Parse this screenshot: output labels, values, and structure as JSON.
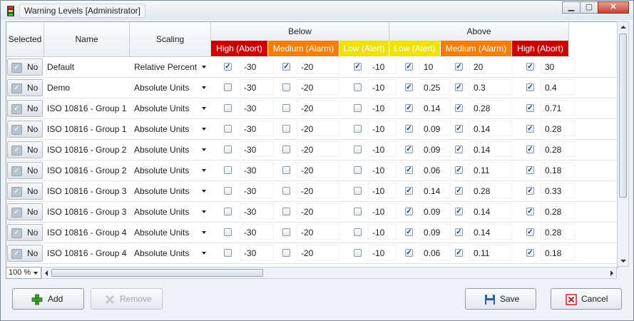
{
  "window": {
    "title": "Warning Levels [Administrator]"
  },
  "colors": {
    "high": "#cc0000",
    "medium": "#ff7b00",
    "low": "#f0e200",
    "checkmark": "#1a3d6b"
  },
  "columns": {
    "selected": "Selected",
    "name": "Name",
    "scaling": "Scaling",
    "below": "Below",
    "above": "Above",
    "below_sub": [
      "High (Abort)",
      "Medium (Alarm)",
      "Low (Alert)"
    ],
    "above_sub": [
      "Low (Alert)",
      "Medium (Alarm)",
      "High (Abort)"
    ]
  },
  "rows": [
    {
      "selected": "No",
      "name": "Default",
      "scaling": "Relative Percent",
      "below": [
        {
          "checked": true,
          "value": "-30"
        },
        {
          "checked": true,
          "value": "-20"
        },
        {
          "checked": true,
          "value": "-10"
        }
      ],
      "above": [
        {
          "checked": true,
          "value": "10"
        },
        {
          "checked": true,
          "value": "20"
        },
        {
          "checked": true,
          "value": "30"
        }
      ]
    },
    {
      "selected": "No",
      "name": "Demo",
      "scaling": "Absolute Units",
      "below": [
        {
          "checked": false,
          "value": "-30"
        },
        {
          "checked": false,
          "value": "-20"
        },
        {
          "checked": false,
          "value": "-10"
        }
      ],
      "above": [
        {
          "checked": true,
          "value": "0.25"
        },
        {
          "checked": true,
          "value": "0.3"
        },
        {
          "checked": true,
          "value": "0.4"
        }
      ]
    },
    {
      "selected": "No",
      "name": "ISO 10816 - Group 1",
      "scaling": "Absolute Units",
      "below": [
        {
          "checked": false,
          "value": "-30"
        },
        {
          "checked": false,
          "value": "-20"
        },
        {
          "checked": false,
          "value": "-10"
        }
      ],
      "above": [
        {
          "checked": true,
          "value": "0.14"
        },
        {
          "checked": true,
          "value": "0.28"
        },
        {
          "checked": true,
          "value": "0.71"
        }
      ]
    },
    {
      "selected": "No",
      "name": "ISO 10816 - Group 1",
      "scaling": "Absolute Units",
      "below": [
        {
          "checked": false,
          "value": "-30"
        },
        {
          "checked": false,
          "value": "-20"
        },
        {
          "checked": false,
          "value": "-10"
        }
      ],
      "above": [
        {
          "checked": true,
          "value": "0.09"
        },
        {
          "checked": true,
          "value": "0.14"
        },
        {
          "checked": true,
          "value": "0.28"
        }
      ]
    },
    {
      "selected": "No",
      "name": "ISO 10816 - Group 2",
      "scaling": "Absolute Units",
      "below": [
        {
          "checked": false,
          "value": "-30"
        },
        {
          "checked": false,
          "value": "-20"
        },
        {
          "checked": false,
          "value": "-10"
        }
      ],
      "above": [
        {
          "checked": true,
          "value": "0.09"
        },
        {
          "checked": true,
          "value": "0.14"
        },
        {
          "checked": true,
          "value": "0.28"
        }
      ]
    },
    {
      "selected": "No",
      "name": "ISO 10816 - Group 2",
      "scaling": "Absolute Units",
      "below": [
        {
          "checked": false,
          "value": "-30"
        },
        {
          "checked": false,
          "value": "-20"
        },
        {
          "checked": false,
          "value": "-10"
        }
      ],
      "above": [
        {
          "checked": true,
          "value": "0.06"
        },
        {
          "checked": true,
          "value": "0.11"
        },
        {
          "checked": true,
          "value": "0.18"
        }
      ]
    },
    {
      "selected": "No",
      "name": "ISO 10816 - Group 3",
      "scaling": "Absolute Units",
      "below": [
        {
          "checked": false,
          "value": "-30"
        },
        {
          "checked": false,
          "value": "-20"
        },
        {
          "checked": false,
          "value": "-10"
        }
      ],
      "above": [
        {
          "checked": true,
          "value": "0.14"
        },
        {
          "checked": true,
          "value": "0.28"
        },
        {
          "checked": true,
          "value": "0.33"
        }
      ]
    },
    {
      "selected": "No",
      "name": "ISO 10816 - Group 3",
      "scaling": "Absolute Units",
      "below": [
        {
          "checked": false,
          "value": "-30"
        },
        {
          "checked": false,
          "value": "-20"
        },
        {
          "checked": false,
          "value": "-10"
        }
      ],
      "above": [
        {
          "checked": true,
          "value": "0.09"
        },
        {
          "checked": true,
          "value": "0.14"
        },
        {
          "checked": true,
          "value": "0.28"
        }
      ]
    },
    {
      "selected": "No",
      "name": "ISO 10816 - Group 4",
      "scaling": "Absolute Units",
      "below": [
        {
          "checked": false,
          "value": "-30"
        },
        {
          "checked": false,
          "value": "-20"
        },
        {
          "checked": false,
          "value": "-10"
        }
      ],
      "above": [
        {
          "checked": true,
          "value": "0.09"
        },
        {
          "checked": true,
          "value": "0.14"
        },
        {
          "checked": true,
          "value": "0.28"
        }
      ]
    },
    {
      "selected": "No",
      "name": "ISO 10816 - Group 4",
      "scaling": "Absolute Units",
      "below": [
        {
          "checked": false,
          "value": "-30"
        },
        {
          "checked": false,
          "value": "-20"
        },
        {
          "checked": false,
          "value": "-10"
        }
      ],
      "above": [
        {
          "checked": true,
          "value": "0.06"
        },
        {
          "checked": true,
          "value": "0.11"
        },
        {
          "checked": true,
          "value": "0.18"
        }
      ]
    }
  ],
  "zoom": "100 %",
  "buttons": {
    "add": "Add",
    "remove": "Remove",
    "save": "Save",
    "cancel": "Cancel"
  },
  "icons": {
    "add": "plus-icon",
    "remove": "x-icon",
    "save": "floppy-disk-icon",
    "cancel": "close-box-icon",
    "app": "traffic-light-icon"
  }
}
